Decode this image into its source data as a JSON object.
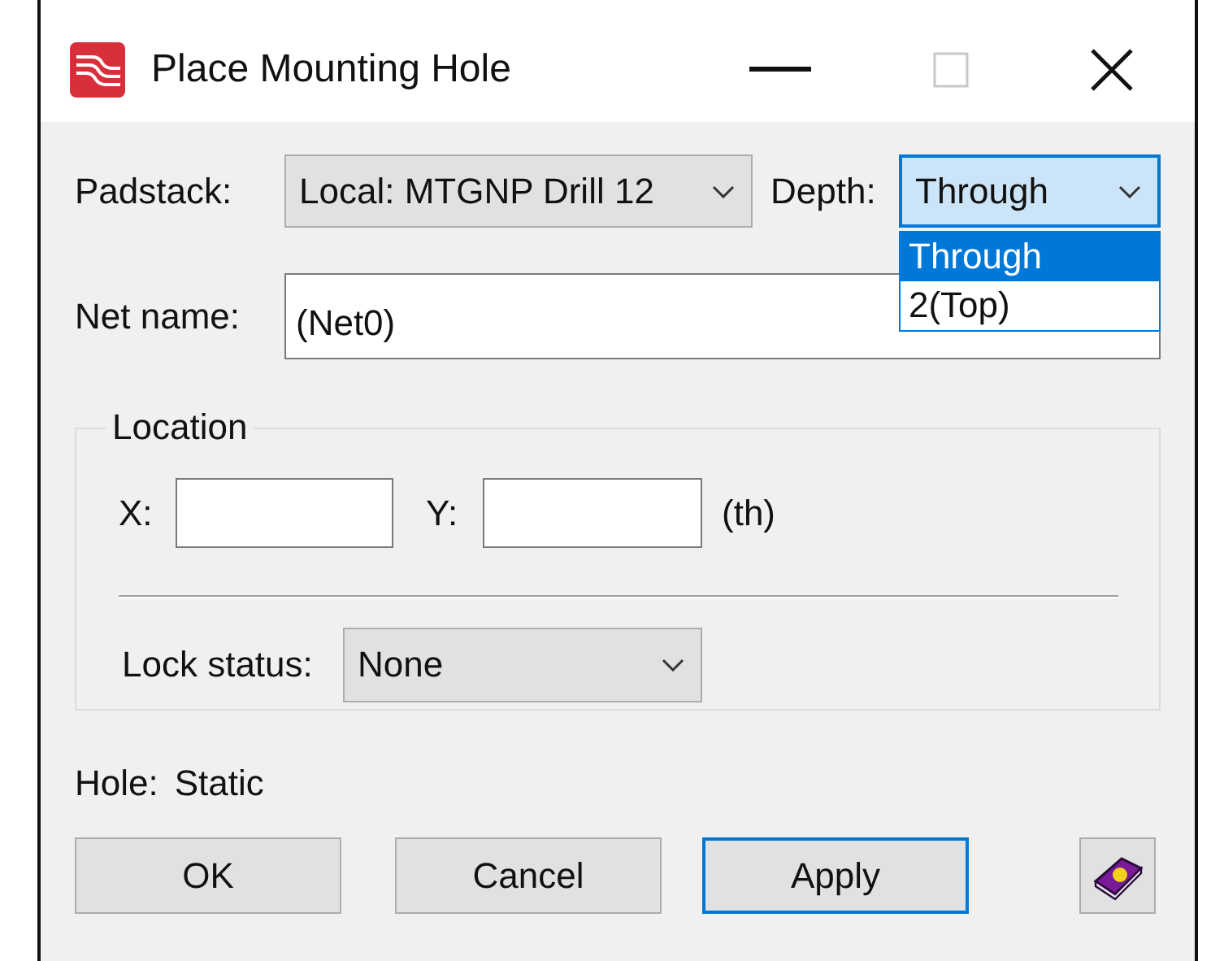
{
  "window": {
    "title": "Place Mounting Hole"
  },
  "padstack": {
    "label": "Padstack:",
    "value": "Local: MTGNP Drill 12"
  },
  "depth": {
    "label": "Depth:",
    "value": "Through",
    "expanded": true,
    "options": [
      {
        "label": "Through",
        "selected": true
      },
      {
        "label": "2(Top)",
        "selected": false
      }
    ]
  },
  "net_name": {
    "label": "Net name:",
    "value": "(Net0)"
  },
  "location": {
    "title": "Location",
    "x_label": "X:",
    "y_label": "Y:",
    "units": "(th)",
    "lock_status": {
      "label": "Lock status:",
      "value": "None"
    }
  },
  "hole": {
    "label": "Hole:",
    "value": "Static"
  },
  "buttons": [
    {
      "label": "OK",
      "focused": false
    },
    {
      "label": "Cancel",
      "focused": false
    },
    {
      "label": "Apply",
      "focused": true
    }
  ]
}
